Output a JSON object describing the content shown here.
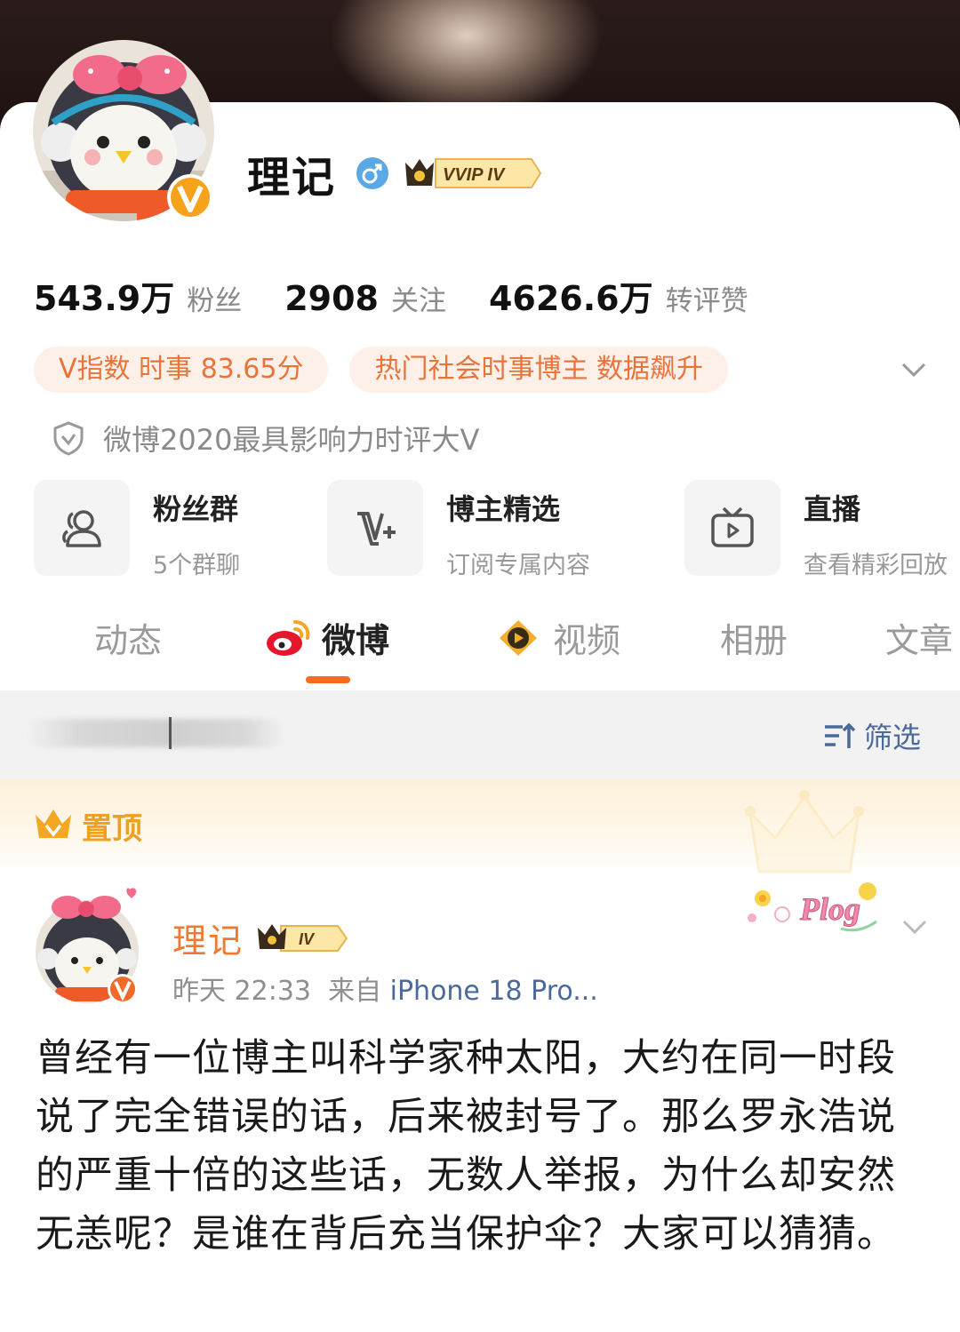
{
  "profile": {
    "name": "理记",
    "vip_badge": "VVIP IV",
    "gender_icon": "male-icon",
    "verified_icon": "verified-v-icon"
  },
  "stats": [
    {
      "value": "543.9万",
      "label": "粉丝"
    },
    {
      "value": "2908",
      "label": "关注"
    },
    {
      "value": "4626.6万",
      "label": "转评赞"
    }
  ],
  "tags": [
    "V指数 时事 83.65分",
    "热门社会时事博主 数据飙升"
  ],
  "honor": "微博2020最具影响力时评大V",
  "entries": [
    {
      "title": "粉丝群",
      "sub": "5个群聊",
      "icon": "fan-group-icon"
    },
    {
      "title": "博主精选",
      "sub": "订阅专属内容",
      "icon": "v-plus-icon"
    },
    {
      "title": "直播",
      "sub": "查看精彩回放",
      "icon": "live-tv-icon"
    }
  ],
  "tabs": [
    "动态",
    "微博",
    "视频",
    "相册",
    "文章"
  ],
  "active_tab": "微博",
  "filter": {
    "label": "筛选"
  },
  "pinned": {
    "label": "置顶"
  },
  "post": {
    "author": "理记",
    "badge": "IV",
    "time": "昨天 22:33",
    "source_prefix": "来自",
    "source": "iPhone 18 Pro...",
    "sticker": "Plog",
    "body": "曾经有一位博主叫科学家种太阳，大约在同一时段说了完全错误的话，后来被封号了。那么罗永浩说的严重十倍的这些话，无数人举报，为什么却安然无恙呢？是谁在背后充当保护伞？大家可以猜猜。"
  },
  "colors": {
    "accent": "#f26d21",
    "tag_text": "#e8743b",
    "tag_bg": "#fdf0e8",
    "link": "#4a6a9a",
    "pinned_gold": "#f0a020"
  }
}
